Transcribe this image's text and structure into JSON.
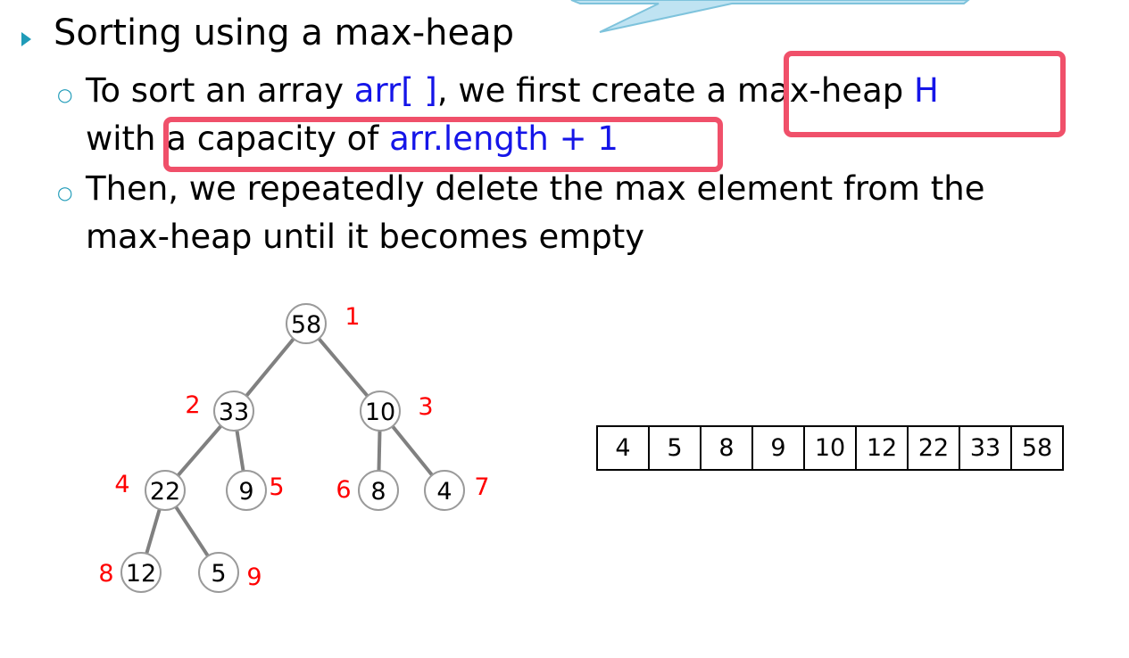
{
  "slide": {
    "heading": "Sorting using a max-heap",
    "bullet1": {
      "line1_pre": "To sort an array ",
      "arr_code": "arr[ ]",
      "line1_mid": ", we first create ",
      "maxheap_text": "a max-heap ",
      "h_code": "H",
      "line2_pre": "with ",
      "capacity_text": "a capacity of ",
      "capacity_code": "arr.length + 1"
    },
    "bullet2": {
      "line1": "Then, we repeatedly delete the max element from the",
      "line2": "max-heap until it becomes empty"
    },
    "icons": {
      "main_bullet": "triangle-bullet-icon",
      "sub_bullet": "circle-bullet-icon"
    }
  },
  "colors": {
    "code": "#1515e8",
    "index_label": "#ff0000",
    "highlight": "#f0506a",
    "callout_fill": "#bfe3f2",
    "bullet": "#1f9bb8"
  },
  "heap": {
    "nodes": [
      {
        "id": 1,
        "value": "58",
        "index": "1"
      },
      {
        "id": 2,
        "value": "33",
        "index": "2"
      },
      {
        "id": 3,
        "value": "10",
        "index": "3"
      },
      {
        "id": 4,
        "value": "22",
        "index": "4"
      },
      {
        "id": 5,
        "value": "9",
        "index": "5"
      },
      {
        "id": 6,
        "value": "8",
        "index": "6"
      },
      {
        "id": 7,
        "value": "4",
        "index": "7"
      },
      {
        "id": 8,
        "value": "12",
        "index": "8"
      },
      {
        "id": 9,
        "value": "5",
        "index": "9"
      }
    ],
    "edges": [
      [
        1,
        2
      ],
      [
        1,
        3
      ],
      [
        2,
        4
      ],
      [
        2,
        5
      ],
      [
        3,
        6
      ],
      [
        3,
        7
      ],
      [
        4,
        8
      ],
      [
        4,
        9
      ]
    ]
  },
  "array": {
    "cells": [
      "4",
      "5",
      "8",
      "9",
      "10",
      "12",
      "22",
      "33",
      "58"
    ]
  }
}
